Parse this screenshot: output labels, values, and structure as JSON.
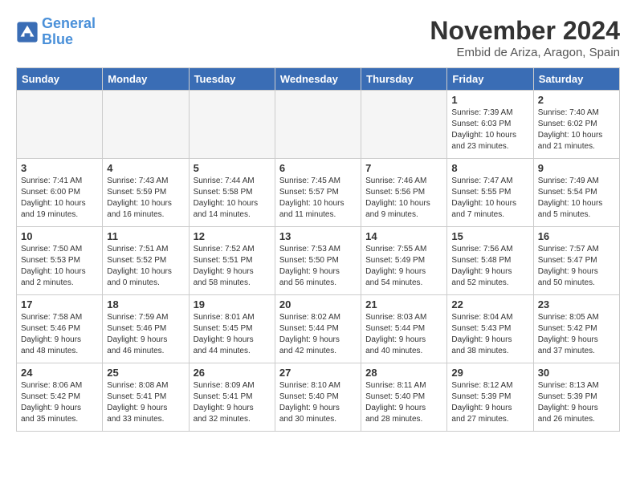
{
  "logo": {
    "line1": "General",
    "line2": "Blue"
  },
  "title": "November 2024",
  "subtitle": "Embid de Ariza, Aragon, Spain",
  "days_of_week": [
    "Sunday",
    "Monday",
    "Tuesday",
    "Wednesday",
    "Thursday",
    "Friday",
    "Saturday"
  ],
  "weeks": [
    [
      {
        "day": "",
        "info": ""
      },
      {
        "day": "",
        "info": ""
      },
      {
        "day": "",
        "info": ""
      },
      {
        "day": "",
        "info": ""
      },
      {
        "day": "",
        "info": ""
      },
      {
        "day": "1",
        "info": "Sunrise: 7:39 AM\nSunset: 6:03 PM\nDaylight: 10 hours\nand 23 minutes."
      },
      {
        "day": "2",
        "info": "Sunrise: 7:40 AM\nSunset: 6:02 PM\nDaylight: 10 hours\nand 21 minutes."
      }
    ],
    [
      {
        "day": "3",
        "info": "Sunrise: 7:41 AM\nSunset: 6:00 PM\nDaylight: 10 hours\nand 19 minutes."
      },
      {
        "day": "4",
        "info": "Sunrise: 7:43 AM\nSunset: 5:59 PM\nDaylight: 10 hours\nand 16 minutes."
      },
      {
        "day": "5",
        "info": "Sunrise: 7:44 AM\nSunset: 5:58 PM\nDaylight: 10 hours\nand 14 minutes."
      },
      {
        "day": "6",
        "info": "Sunrise: 7:45 AM\nSunset: 5:57 PM\nDaylight: 10 hours\nand 11 minutes."
      },
      {
        "day": "7",
        "info": "Sunrise: 7:46 AM\nSunset: 5:56 PM\nDaylight: 10 hours\nand 9 minutes."
      },
      {
        "day": "8",
        "info": "Sunrise: 7:47 AM\nSunset: 5:55 PM\nDaylight: 10 hours\nand 7 minutes."
      },
      {
        "day": "9",
        "info": "Sunrise: 7:49 AM\nSunset: 5:54 PM\nDaylight: 10 hours\nand 5 minutes."
      }
    ],
    [
      {
        "day": "10",
        "info": "Sunrise: 7:50 AM\nSunset: 5:53 PM\nDaylight: 10 hours\nand 2 minutes."
      },
      {
        "day": "11",
        "info": "Sunrise: 7:51 AM\nSunset: 5:52 PM\nDaylight: 10 hours\nand 0 minutes."
      },
      {
        "day": "12",
        "info": "Sunrise: 7:52 AM\nSunset: 5:51 PM\nDaylight: 9 hours\nand 58 minutes."
      },
      {
        "day": "13",
        "info": "Sunrise: 7:53 AM\nSunset: 5:50 PM\nDaylight: 9 hours\nand 56 minutes."
      },
      {
        "day": "14",
        "info": "Sunrise: 7:55 AM\nSunset: 5:49 PM\nDaylight: 9 hours\nand 54 minutes."
      },
      {
        "day": "15",
        "info": "Sunrise: 7:56 AM\nSunset: 5:48 PM\nDaylight: 9 hours\nand 52 minutes."
      },
      {
        "day": "16",
        "info": "Sunrise: 7:57 AM\nSunset: 5:47 PM\nDaylight: 9 hours\nand 50 minutes."
      }
    ],
    [
      {
        "day": "17",
        "info": "Sunrise: 7:58 AM\nSunset: 5:46 PM\nDaylight: 9 hours\nand 48 minutes."
      },
      {
        "day": "18",
        "info": "Sunrise: 7:59 AM\nSunset: 5:46 PM\nDaylight: 9 hours\nand 46 minutes."
      },
      {
        "day": "19",
        "info": "Sunrise: 8:01 AM\nSunset: 5:45 PM\nDaylight: 9 hours\nand 44 minutes."
      },
      {
        "day": "20",
        "info": "Sunrise: 8:02 AM\nSunset: 5:44 PM\nDaylight: 9 hours\nand 42 minutes."
      },
      {
        "day": "21",
        "info": "Sunrise: 8:03 AM\nSunset: 5:44 PM\nDaylight: 9 hours\nand 40 minutes."
      },
      {
        "day": "22",
        "info": "Sunrise: 8:04 AM\nSunset: 5:43 PM\nDaylight: 9 hours\nand 38 minutes."
      },
      {
        "day": "23",
        "info": "Sunrise: 8:05 AM\nSunset: 5:42 PM\nDaylight: 9 hours\nand 37 minutes."
      }
    ],
    [
      {
        "day": "24",
        "info": "Sunrise: 8:06 AM\nSunset: 5:42 PM\nDaylight: 9 hours\nand 35 minutes."
      },
      {
        "day": "25",
        "info": "Sunrise: 8:08 AM\nSunset: 5:41 PM\nDaylight: 9 hours\nand 33 minutes."
      },
      {
        "day": "26",
        "info": "Sunrise: 8:09 AM\nSunset: 5:41 PM\nDaylight: 9 hours\nand 32 minutes."
      },
      {
        "day": "27",
        "info": "Sunrise: 8:10 AM\nSunset: 5:40 PM\nDaylight: 9 hours\nand 30 minutes."
      },
      {
        "day": "28",
        "info": "Sunrise: 8:11 AM\nSunset: 5:40 PM\nDaylight: 9 hours\nand 28 minutes."
      },
      {
        "day": "29",
        "info": "Sunrise: 8:12 AM\nSunset: 5:39 PM\nDaylight: 9 hours\nand 27 minutes."
      },
      {
        "day": "30",
        "info": "Sunrise: 8:13 AM\nSunset: 5:39 PM\nDaylight: 9 hours\nand 26 minutes."
      }
    ]
  ]
}
